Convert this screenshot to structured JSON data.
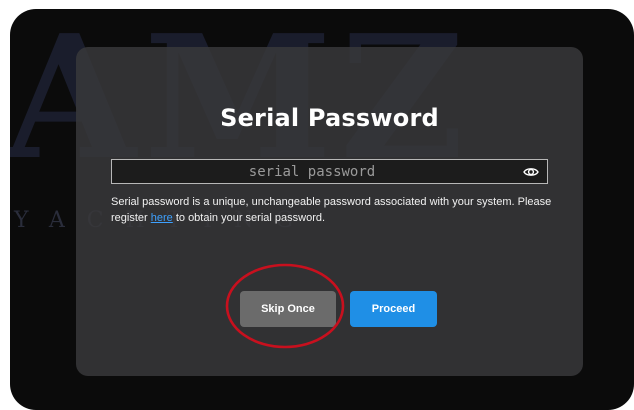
{
  "watermark": {
    "big": "AMZ",
    "small": "YACHTING"
  },
  "dialog": {
    "title": "Serial Password",
    "input": {
      "value": "",
      "placeholder": "serial password"
    },
    "help": {
      "before_link": "Serial password is a unique, unchangeable password associated with your system. Please register ",
      "link": "here",
      "after_link": " to obtain your serial password."
    },
    "buttons": {
      "skip_label": "Skip Once",
      "proceed_label": "Proceed"
    }
  },
  "colors": {
    "dialog_bg": "#38383a",
    "proceed": "#1f8fe6",
    "skip": "#6b6b6b",
    "link": "#3ea1ff",
    "annotation_circle": "#c8101e"
  },
  "icons": {
    "password_toggle": "eye-icon"
  }
}
